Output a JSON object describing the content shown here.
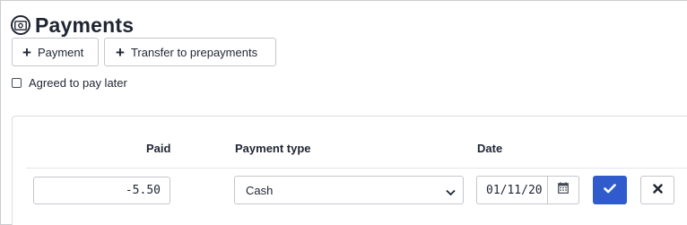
{
  "page": {
    "title": "Payments",
    "icon": "money-icon"
  },
  "toolbar": {
    "payment_label": "Payment",
    "transfer_label": "Transfer to prepayments",
    "plus_icon": "plus-icon"
  },
  "agree": {
    "label": "Agreed to pay later",
    "checked": false
  },
  "table": {
    "headers": {
      "paid": "Paid",
      "payment_type": "Payment type",
      "date": "Date"
    },
    "row": {
      "paid": "-5.50",
      "payment_type": "Cash",
      "date": "01/11/20",
      "calendar_icon": "calendar-icon",
      "confirm_icon": "check-icon",
      "cancel_icon": "close-icon"
    }
  },
  "colors": {
    "accent": "#2f5bcc",
    "border": "#c3c6cc",
    "text": "#1e2533"
  }
}
